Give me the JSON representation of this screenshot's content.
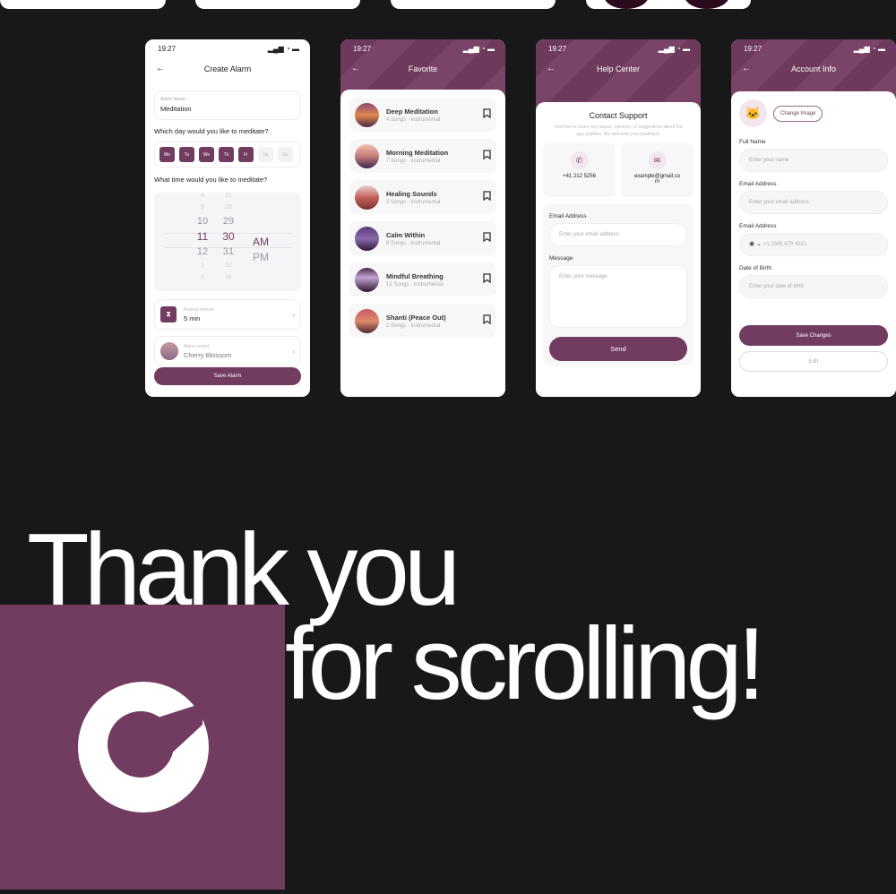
{
  "colors": {
    "accent": "#713c5f",
    "background": "#181818"
  },
  "status_time": "19:27",
  "create_alarm": {
    "title": "Create Alarm",
    "alarm_name_label": "Alarm Name",
    "alarm_name": "Meditation",
    "day_question": "Which day would you like to meditate?",
    "days": [
      {
        "label": "Mo",
        "selected": true
      },
      {
        "label": "Tu",
        "selected": true
      },
      {
        "label": "We",
        "selected": true
      },
      {
        "label": "Th",
        "selected": true
      },
      {
        "label": "Fr",
        "selected": true
      },
      {
        "label": "Sa",
        "selected": false
      },
      {
        "label": "Su",
        "selected": false
      }
    ],
    "time_question": "What time would you like to meditate?",
    "hours": [
      "8",
      "9",
      "10",
      "11",
      "12",
      "1",
      "2"
    ],
    "minutes": [
      "27",
      "28",
      "29",
      "30",
      "31",
      "32",
      "33"
    ],
    "periods": [
      "AM",
      "PM"
    ],
    "selected": {
      "hour": "11",
      "minute": "30",
      "period": "AM"
    },
    "repeat_label": "Repeat interval",
    "repeat_value": "5 min",
    "sound_label": "Alarm sound",
    "sound_value": "Cherry Blossom",
    "save": "Save Alarm"
  },
  "favorite": {
    "title": "Favorite",
    "items": [
      {
        "title": "Deep Meditation",
        "sub": "4 Songs · Instrumental"
      },
      {
        "title": "Morning Meditation",
        "sub": "7 Songs · Instrumental"
      },
      {
        "title": "Healing Sounds",
        "sub": "2 Songs · Instrumental"
      },
      {
        "title": "Calm Within",
        "sub": "6 Songs · Instrumental"
      },
      {
        "title": "Mindful Breathing",
        "sub": "12 Songs · Instrumental"
      },
      {
        "title": "Shanti (Peace Out)",
        "sub": "2 Songs · Instrumental"
      }
    ]
  },
  "help": {
    "title": "Help Center",
    "heading": "Contact Support",
    "desc": "Feel free to share any issues, opinions, or suggestions about the app anytime. We welcome your feedback!",
    "phone": "+41 212 5256",
    "email": "example@gmail.com",
    "email_label": "Email Address",
    "email_placeholder": "Enter your email address",
    "message_label": "Message",
    "message_placeholder": "Enter your message",
    "send": "Send"
  },
  "account": {
    "title": "Account Info",
    "change_image": "Change Image",
    "full_name_label": "Full Name",
    "full_name_placeholder": "Enter your name",
    "email_label": "Email Address",
    "email_placeholder": "Enter your email address",
    "phone_label": "Email Address",
    "phone_placeholder": "+1  2345 678 4321",
    "dob_label": "Date of Birth",
    "dob_placeholder": "Enter your date of birth",
    "save": "Save Changes",
    "edit": "Edit"
  },
  "thanks": {
    "line1": "Thank you",
    "line2": "for scrolling!"
  }
}
